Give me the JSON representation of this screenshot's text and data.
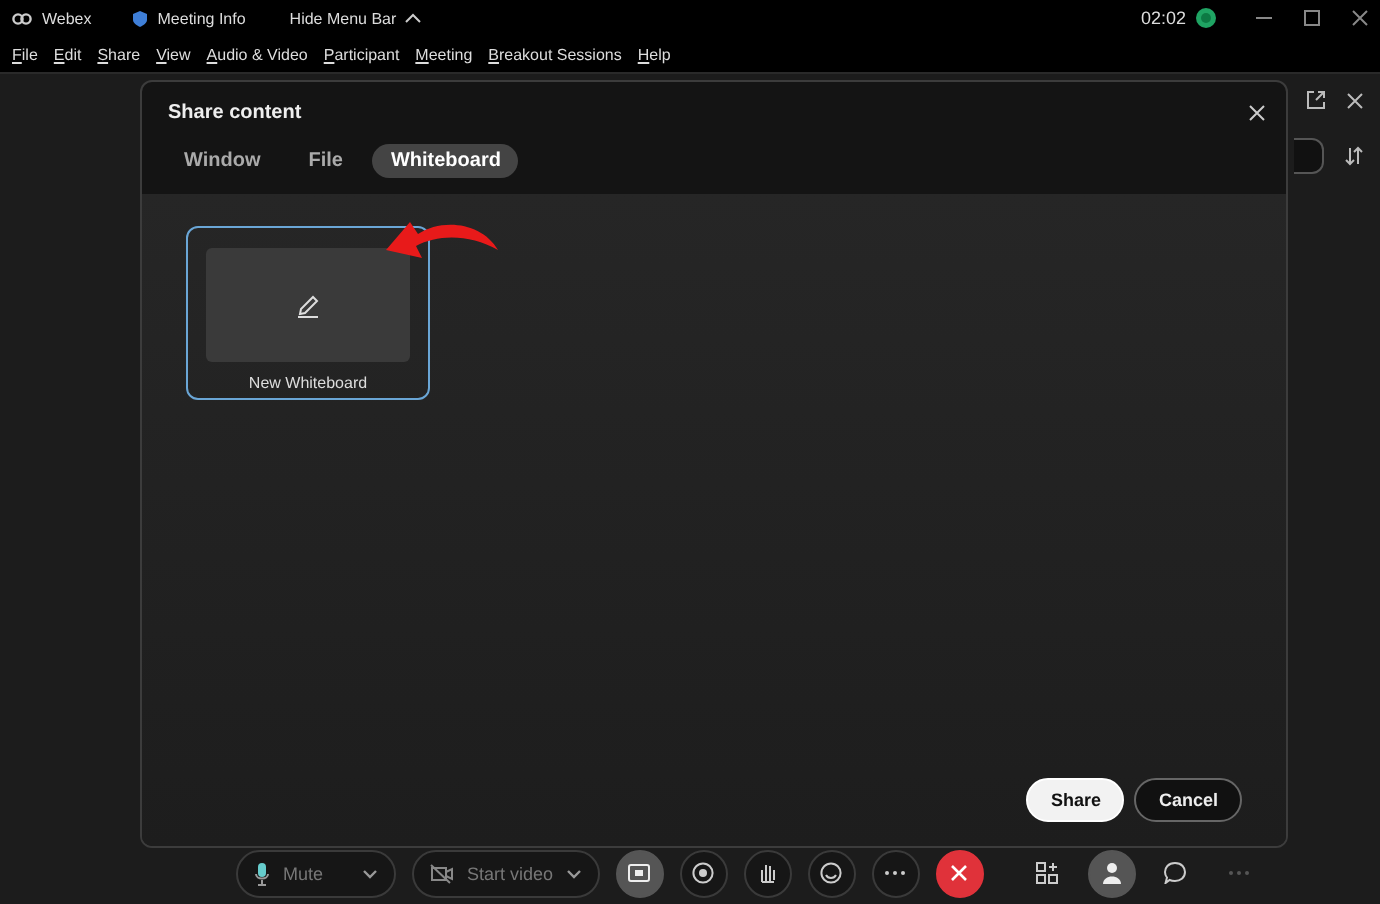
{
  "title_bar": {
    "app_name": "Webex",
    "meeting_info": "Meeting Info",
    "hide_menu": "Hide Menu Bar",
    "time": "02:02"
  },
  "menu": [
    "File",
    "Edit",
    "Share",
    "View",
    "Audio & Video",
    "Participant",
    "Meeting",
    "Breakout Sessions",
    "Help"
  ],
  "dialog": {
    "title": "Share content",
    "tabs": [
      {
        "label": "Window",
        "selected": false
      },
      {
        "label": "File",
        "selected": false
      },
      {
        "label": "Whiteboard",
        "selected": true
      }
    ],
    "items": [
      {
        "label": "New Whiteboard",
        "selected": true
      }
    ],
    "buttons": [
      {
        "label": "Share",
        "kind": "primary"
      },
      {
        "label": "Cancel",
        "kind": "secondary"
      }
    ]
  },
  "controls": {
    "mute": "Mute",
    "video": "Start video"
  }
}
